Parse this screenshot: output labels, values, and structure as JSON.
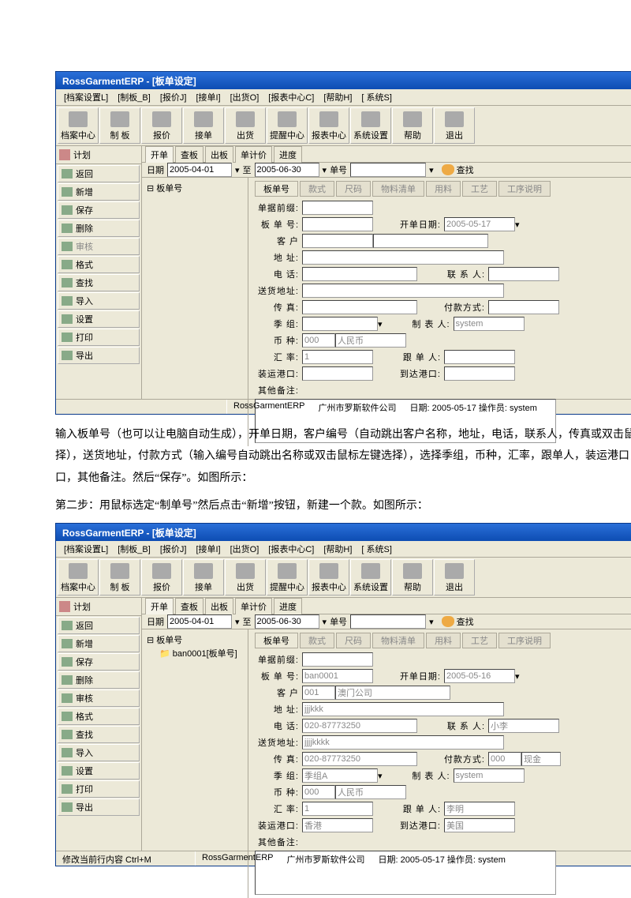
{
  "app": {
    "title": "RossGarmentERP - [板单设定]"
  },
  "menu": [
    "[档案设置L]",
    "[制板_B]",
    "[报价J]",
    "[接单I]",
    "[出货O]",
    "[报表中心C]",
    "[帮助H]",
    "[ 系统S]"
  ],
  "tbar": [
    {
      "l": "档案中心"
    },
    {
      "l": "制 板"
    },
    {
      "l": "报价"
    },
    {
      "l": "接单"
    },
    {
      "l": "出货"
    },
    {
      "l": "提醒中心"
    },
    {
      "l": "报表中心"
    },
    {
      "l": "系统设置"
    },
    {
      "l": "帮助"
    },
    {
      "l": "退出"
    }
  ],
  "side": {
    "top": "计划",
    "back": "返回",
    "items": [
      "新增",
      "保存",
      "删除",
      "审核",
      "格式",
      "查找",
      "导入",
      "设置",
      "打印",
      "导出"
    ]
  },
  "tabs": [
    "开单",
    "查板",
    "出板",
    "单计价",
    "进度"
  ],
  "filter": {
    "date": "日期",
    "d1": "2005-04-01",
    "to": "至",
    "d2": "2005-06-30",
    "dh": "单号",
    "search": "查找"
  },
  "ftabs": [
    "板单号",
    "款式",
    "尺码",
    "物料清单",
    "用料",
    "工艺",
    "工序说明"
  ],
  "form1": {
    "prefix_l": "单据前缀:",
    "prefix_v": "",
    "bdh_l": "板 单 号:",
    "bdh_v": "",
    "kdrq_l": "开单日期:",
    "kdrq_v": "2005-05-17",
    "kh_l": "客   户",
    "kh_v": "",
    "dz_l": "地   址:",
    "dz_v": "",
    "dh_l": "电   话:",
    "dh_v": "",
    "lxr_l": "联 系 人:",
    "lxr_v": "",
    "shdz_l": "送货地址:",
    "shdz_v": "",
    "cz_l": "传   真:",
    "cz_v": "",
    "fkfs_l": "付款方式:",
    "fkfs_v": "",
    "jz_l": "季   组:",
    "jz_v": "",
    "zdr_l": "制 表 人:",
    "zdr_v": "system",
    "bz_l": "币   种:",
    "bz_v": "000",
    "bzn": "人民币",
    "hl_l": "汇   率:",
    "hl_v": "1",
    "gdr_l": "跟 单 人:",
    "gdr_v": "",
    "zygk_l": "装运港口:",
    "zygk_v": "",
    "ddgk_l": "到达港口:",
    "ddgk_v": "",
    "qtbz_l": "其他备注:"
  },
  "form2": {
    "prefix_v": "",
    "bdh_v": "ban0001",
    "kdrq_v": "2005-05-16",
    "kh_v": "001",
    "kh_n": "澳门公司",
    "dz_v": "jjjkkk",
    "dh_v": "020-87773250",
    "lxr_v": "小李",
    "shdz_v": "jjjjkkkk",
    "cz_v": "020-87773250",
    "fkfs_v": "000",
    "fkfs_n": "现金",
    "jz_v": "季组A",
    "zdr_v": "system",
    "bz_v": "000",
    "bzn": "人民币",
    "hl_v": "1",
    "gdr_v": "李明",
    "zygk_v": "香港",
    "ddgk_v": "美国"
  },
  "tree1": {
    "root": "板单号"
  },
  "tree2": {
    "root": "板单号",
    "child": "ban0001[板单号]"
  },
  "status": {
    "s0": "",
    "s1": "修改当前行内容 Ctrl+M",
    "app": "RossGarmentERP",
    "co": "广州市罗斯软件公司",
    "dt": "日期: 2005-05-17 操作员: system"
  },
  "text": {
    "p1": "输入板单号（也可以让电脑自动生成），开单日期，客户编号（自动跳出客户名称，地址，电话，联系人，传真或双击鼠标左键选择），送货地址，付款方式（输入编号自动跳出名称或双击鼠标左键选择），选择季组，币种，汇率，跟单人，装运港口，到达港口，其他备注。然后“保存”。如图所示：",
    "p2": "第二步：用鼠标选定“制单号”然后点击“新增”按钮，新建一个款。如图所示："
  }
}
